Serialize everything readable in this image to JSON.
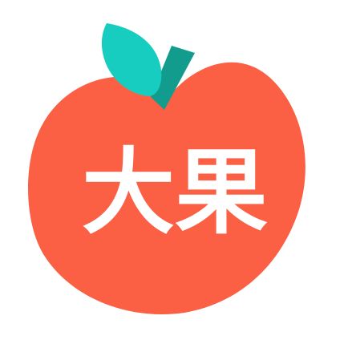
{
  "logo": {
    "text": "大果",
    "colors": {
      "apple_body": "#FB5F44",
      "leaf": "#16CDBF",
      "stem": "#129C8D",
      "text": "#FFFFFF",
      "background": "#FFFFFF"
    },
    "icons": [
      "apple-icon",
      "leaf-icon",
      "stem-icon"
    ]
  }
}
